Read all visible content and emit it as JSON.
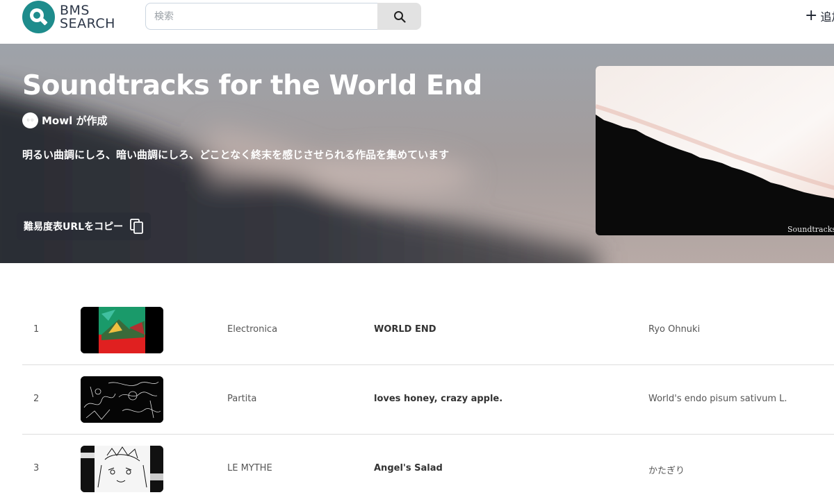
{
  "header": {
    "logo_line1": "BMS",
    "logo_line2": "SEARCH",
    "search_placeholder": "検索",
    "search_value": "",
    "add_label": "追加"
  },
  "hero": {
    "title": "Soundtracks for the World End",
    "creator": "Mowl が作成",
    "description": "明るい曲調にしろ、暗い曲調にしろ、どことなく終末を感じさせられる作品を集めています",
    "copy_button_label": "難易度表URLをコピー",
    "banner_caption": "Soundtracks for the World End"
  },
  "tracks": [
    {
      "rank": "1",
      "genre": "Electronica",
      "title": "WORLD END",
      "artist": "Ryo Ohnuki"
    },
    {
      "rank": "2",
      "genre": "Partita",
      "title": "loves honey, crazy apple.",
      "artist": "World's endo pisum sativum L."
    },
    {
      "rank": "3",
      "genre": "LE MYTHE",
      "title": "Angel's Salad",
      "artist": "かたぎり"
    }
  ],
  "colors": {
    "brand": "#1e8c8c",
    "hero_overlay": "#9aa0a8",
    "divider": "#dddddd"
  }
}
